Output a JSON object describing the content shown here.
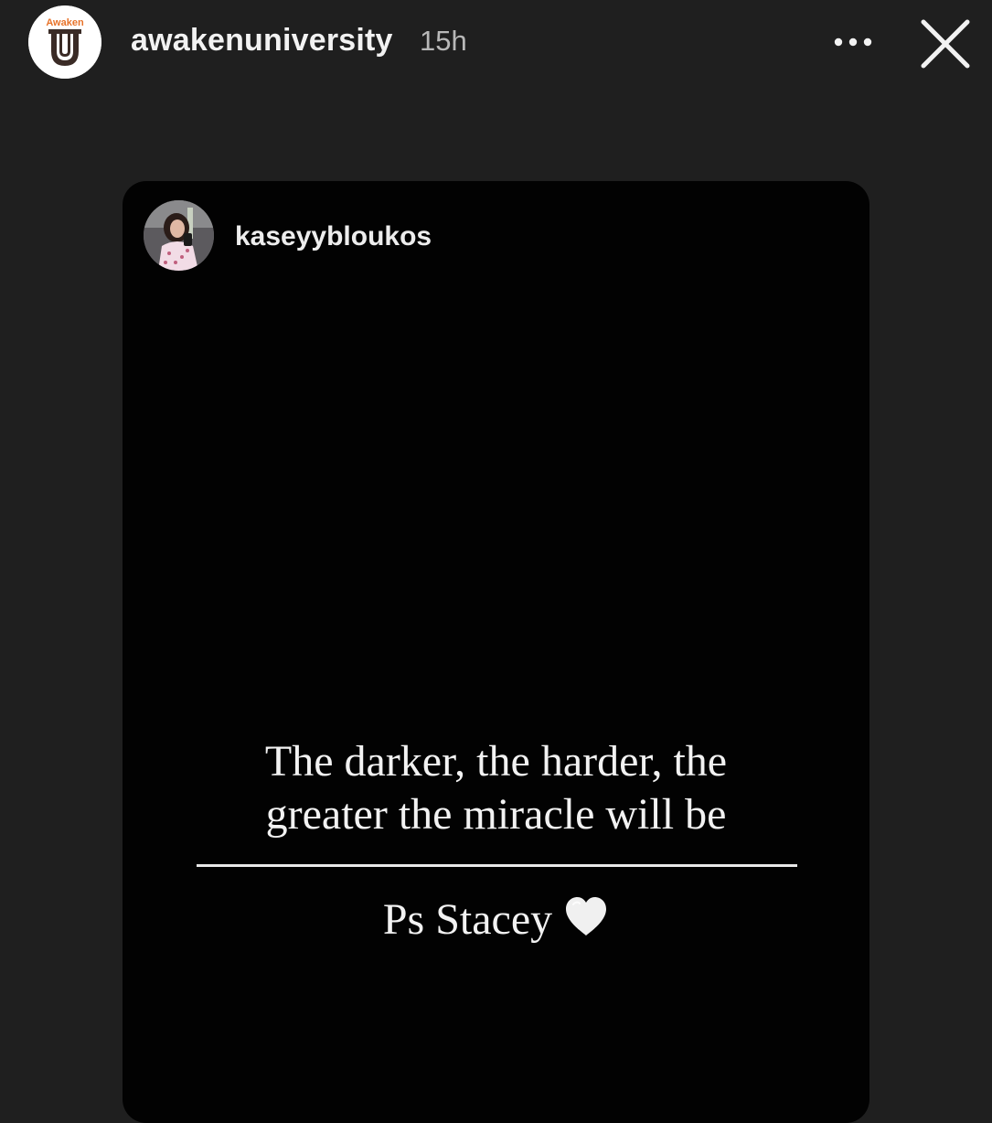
{
  "header": {
    "account_name": "awakenuniversity",
    "post_age": "15h",
    "avatar": {
      "logo_text": "Awaken",
      "logo_letter": "U",
      "icon": "awaken-university-logo"
    },
    "more_icon": "ellipsis-icon",
    "close_icon": "close-icon"
  },
  "shared_story": {
    "username": "kaseyybloukos",
    "avatar_icon": "profile-photo",
    "quote_line_1": "The darker, the harder, the",
    "quote_line_2": "greater the miracle will be",
    "author": "Ps Stacey",
    "author_emoji": "white-heart-icon"
  },
  "colors": {
    "background": "#1f1f1f",
    "card": "#020202",
    "text": "#f2f2f2",
    "muted_text": "#b8b8b8",
    "logo_orange": "#e8732a",
    "logo_dark": "#3a2b26"
  }
}
